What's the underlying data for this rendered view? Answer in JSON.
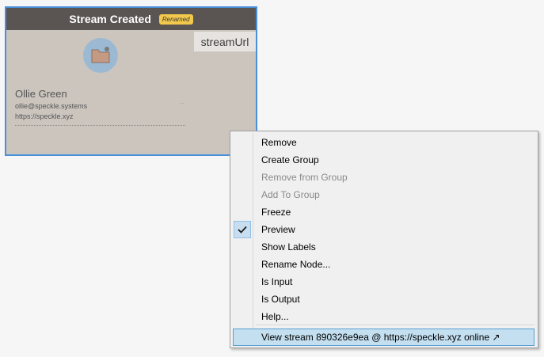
{
  "node": {
    "title": "Stream Created",
    "badge": "Renamed",
    "output_port": "streamUrl",
    "user_name": "Ollie Green",
    "user_email": "ollie@speckle.systems",
    "server_url": "https://speckle.xyz",
    "avatar_icon": "folder-icon",
    "colors": {
      "header": "#5a5552",
      "body": "#cbc5be",
      "selection_border": "#4a90d9",
      "badge": "#f2c94c",
      "avatar": "#9cb9d3"
    }
  },
  "context_menu": {
    "items": [
      {
        "label": "Remove",
        "enabled": true
      },
      {
        "label": "Create Group",
        "enabled": true
      },
      {
        "label": "Remove from Group",
        "enabled": false
      },
      {
        "label": "Add To Group",
        "enabled": false
      },
      {
        "label": "Freeze",
        "enabled": true
      },
      {
        "label": "Preview",
        "enabled": true,
        "checked": true
      },
      {
        "label": "Show Labels",
        "enabled": true
      },
      {
        "label": "Rename Node...",
        "enabled": true
      },
      {
        "label": "Is Input",
        "enabled": true
      },
      {
        "label": "Is Output",
        "enabled": true
      },
      {
        "label": "Help...",
        "enabled": true
      }
    ],
    "view_stream": "View stream 890326e9ea @ https://speckle.xyz online ↗",
    "colors": {
      "highlight": "#c3dff0",
      "highlight_border": "#5a9fd1",
      "disabled_text": "#8a8a8a"
    }
  }
}
